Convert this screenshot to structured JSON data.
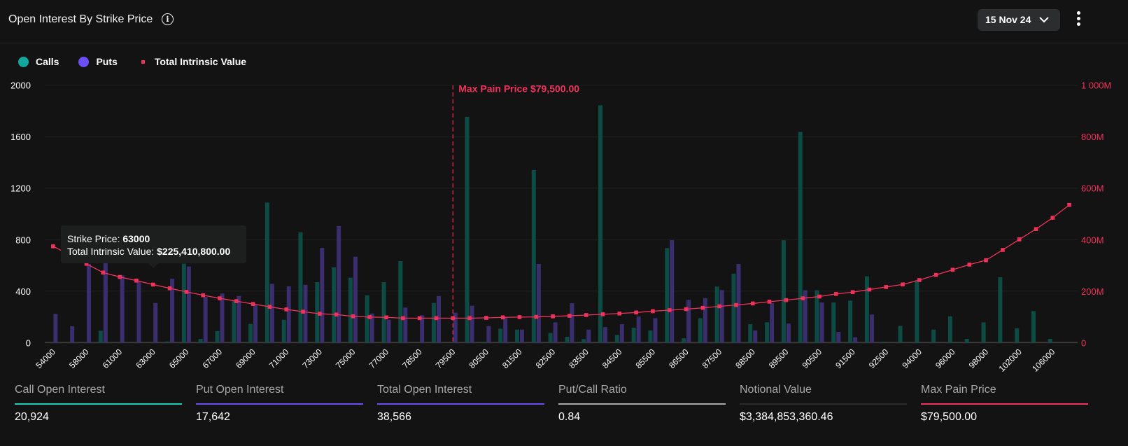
{
  "header": {
    "title": "Open Interest By Strike Price",
    "info_icon": "info-icon",
    "date": "15 Nov 24",
    "menu_icon": "more-vertical-icon"
  },
  "legend": [
    {
      "label": "Calls",
      "color": "#13a89e",
      "shape": "circle"
    },
    {
      "label": "Puts",
      "color": "#6c4ef7",
      "shape": "circle"
    },
    {
      "label": "Total Intrinsic Value",
      "color": "#f0325a",
      "shape": "square"
    }
  ],
  "tooltip": {
    "strike_label": "Strike Price:",
    "strike_value": "63000",
    "value_label": "Total Intrinsic Value:",
    "value_value": "$225,410,800.00"
  },
  "chart_data": {
    "type": "bar",
    "categories": [
      "54000",
      "",
      "58000",
      "",
      "61000",
      "",
      "63000",
      "",
      "65000",
      "",
      "67000",
      "",
      "69000",
      "",
      "71000",
      "",
      "73000",
      "",
      "75000",
      "",
      "77000",
      "",
      "78500",
      "",
      "79500",
      "",
      "80500",
      "",
      "81500",
      "",
      "82500",
      "",
      "83500",
      "",
      "84500",
      "",
      "85500",
      "",
      "86500",
      "",
      "87500",
      "",
      "88500",
      "",
      "89500",
      "",
      "90500",
      "",
      "91500",
      "",
      "92500",
      "",
      "94000",
      "",
      "96000",
      "",
      "98000",
      "",
      "102000",
      "",
      "106000",
      ""
    ],
    "series": [
      {
        "name": "Calls",
        "type": "bar",
        "axis": "left",
        "color": "#0d4b45",
        "values": [
          0,
          0,
          0,
          92,
          0,
          0,
          0,
          8,
          613,
          29,
          90,
          326,
          145,
          1088,
          177,
          857,
          469,
          585,
          504,
          368,
          469,
          633,
          0,
          308,
          0,
          1754,
          5,
          108,
          101,
          1341,
          75,
          45,
          27,
          1844,
          60,
          116,
          94,
          734,
          34,
          190,
          435,
          536,
          143,
          158,
          795,
          1637,
          407,
          312,
          326,
          515,
          7,
          130,
          485,
          101,
          204,
          29,
          157,
          508,
          110,
          245,
          29,
          0
        ]
      },
      {
        "name": "Puts",
        "type": "bar",
        "axis": "left",
        "color": "#3a2e6e",
        "values": [
          223,
          127,
          610,
          730,
          522,
          471,
          308,
          497,
          591,
          355,
          381,
          362,
          295,
          457,
          437,
          449,
          736,
          906,
          667,
          226,
          177,
          272,
          212,
          362,
          232,
          286,
          128,
          192,
          101,
          611,
          157,
          306,
          101,
          121,
          143,
          203,
          190,
          796,
          333,
          346,
          408,
          611,
          94,
          306,
          148,
          407,
          312,
          83,
          41,
          218,
          0,
          0,
          0,
          0,
          0,
          0,
          0,
          0,
          0,
          0,
          0,
          0
        ]
      },
      {
        "name": "Total Intrinsic Value",
        "type": "line",
        "axis": "right",
        "unit": "M",
        "color": "#f0325a",
        "values": [
          374,
          341,
          306,
          272,
          255,
          241,
          225.4,
          211,
          197,
          184,
          172,
          161,
          150,
          139,
          129,
          120,
          112,
          109,
          102,
          99,
          98,
          95,
          95,
          95,
          95,
          95,
          96,
          98,
          99,
          100,
          102,
          104,
          107,
          110,
          113,
          117,
          122,
          126,
          130,
          135,
          141,
          146,
          152,
          159,
          165,
          172,
          179,
          189,
          196,
          206,
          216,
          226,
          243,
          263,
          283,
          303,
          320,
          360,
          401,
          441,
          485,
          535
        ]
      }
    ],
    "y_left": {
      "ticks": [
        "0",
        "400",
        "800",
        "1200",
        "1600",
        "2000"
      ],
      "range": [
        0,
        2000
      ]
    },
    "y_right": {
      "ticks": [
        "0",
        "200M",
        "400M",
        "600M",
        "800M",
        "1 000M"
      ],
      "range": [
        0,
        1000
      ]
    },
    "annotation": {
      "label": "Max Pain Price $79,500.00",
      "category": "79500"
    },
    "grid": true
  },
  "stats": [
    {
      "label": "Call Open Interest",
      "value": "20,924",
      "color": "#1ccfb8"
    },
    {
      "label": "Put Open Interest",
      "value": "17,642",
      "color": "#6c4ef7"
    },
    {
      "label": "Total Open Interest",
      "value": "38,566",
      "color": "#6c4ef7"
    },
    {
      "label": "Put/Call Ratio",
      "value": "0.84",
      "color": "#a8aaa8"
    },
    {
      "label": "Notional Value",
      "value": "$3,384,853,360.46",
      "color": "#2a2a2a"
    },
    {
      "label": "Max Pain Price",
      "value": "$79,500.00",
      "color": "#f0325a"
    }
  ]
}
